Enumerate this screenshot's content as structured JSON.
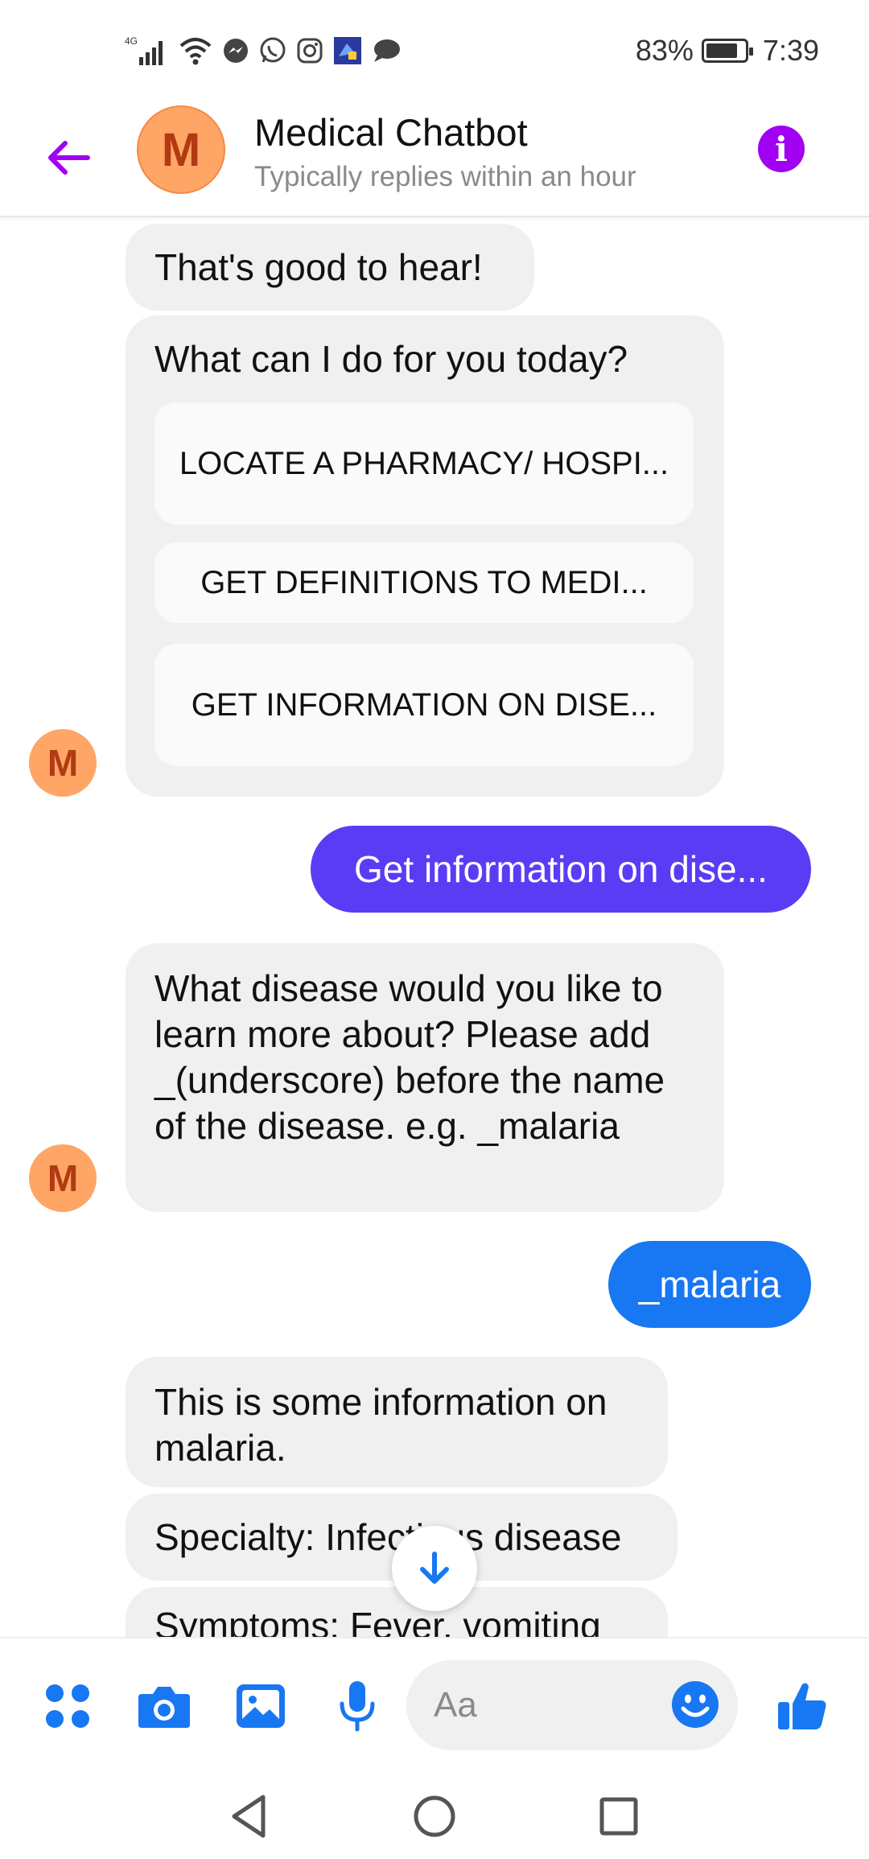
{
  "status_bar": {
    "network": "4G",
    "battery": "83%",
    "battery_level": 0.83,
    "time": "7:39"
  },
  "header": {
    "avatar_letter": "M",
    "title": "Medical Chatbot",
    "subtitle": "Typically replies within an hour"
  },
  "chat": {
    "bot_avatar_letter": "M",
    "messages": [
      {
        "from": "bot",
        "text": "That's good to hear!"
      },
      {
        "from": "bot",
        "text": "What can I do for you today?",
        "quick_replies": [
          "LOCATE A PHARMACY/ HOSPI...",
          "GET DEFINITIONS TO MEDI...",
          "GET INFORMATION ON DISE..."
        ]
      },
      {
        "from": "user",
        "text": "Get information on dise..."
      },
      {
        "from": "bot",
        "text": "What disease would you like to learn more about? Please add _(underscore) before the name of the disease. e.g. _malaria"
      },
      {
        "from": "user",
        "text": "_malaria"
      },
      {
        "from": "bot",
        "text": "This is some information on malaria."
      },
      {
        "from": "bot",
        "text": "Specialty: Infectious disease"
      },
      {
        "from": "bot",
        "text": "Symptoms: Fever, vomiting"
      }
    ]
  },
  "composer": {
    "placeholder": "Aa"
  },
  "colors": {
    "accent_purple": "#a100f2",
    "user_bubble_violet": "#5b3cf5",
    "user_bubble_blue": "#1877f2",
    "messenger_blue": "#1877f2",
    "avatar_orange": "#ffa566"
  },
  "icons": {
    "back": "arrow-left-icon",
    "info": "info-icon",
    "scroll": "arrow-down-icon",
    "menu": "four-dots-icon",
    "camera": "camera-icon",
    "gallery": "image-icon",
    "voice": "microphone-icon",
    "emoji": "smiley-icon",
    "like": "thumbs-up-icon"
  }
}
